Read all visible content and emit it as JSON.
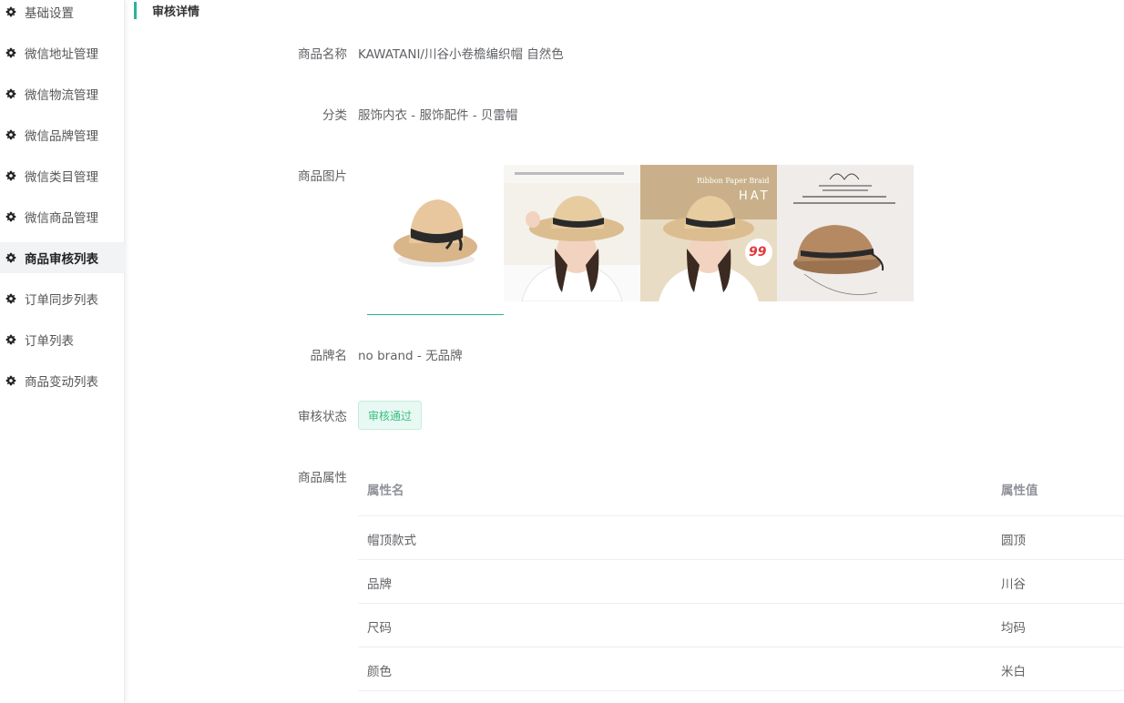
{
  "sidebar": {
    "items": [
      {
        "label": "基础设置"
      },
      {
        "label": "微信地址管理"
      },
      {
        "label": "微信物流管理"
      },
      {
        "label": "微信品牌管理"
      },
      {
        "label": "微信类目管理"
      },
      {
        "label": "微信商品管理"
      },
      {
        "label": "商品审核列表"
      },
      {
        "label": "订单同步列表"
      },
      {
        "label": "订单列表"
      },
      {
        "label": "商品变动列表"
      }
    ],
    "active_index": 6,
    "icon": "gear-icon"
  },
  "header": {
    "title": "审核详情",
    "accent_color": "#2bb39b"
  },
  "detail": {
    "name_label": "商品名称",
    "name_value": "KAWATANI/川谷小卷檐编织帽 自然色",
    "category_label": "分类",
    "category_value": "服饰内衣 - 服饰配件 - 贝雷帽",
    "images_label": "商品图片",
    "brand_label": "品牌名",
    "brand_value": "no brand - 无品牌",
    "status_label": "审核状态",
    "status_value": "审核通过",
    "status_color": "#3bbf84",
    "attrs_label": "商品属性"
  },
  "attributes": {
    "col_name": "属性名",
    "col_value": "属性值",
    "rows": [
      {
        "name": "帽顶款式",
        "value": "圆顶"
      },
      {
        "name": "品牌",
        "value": "川谷"
      },
      {
        "name": "尺码",
        "value": "均码"
      },
      {
        "name": "颜色",
        "value": "米白"
      }
    ]
  },
  "images": {
    "img2_caption": "Ribbon Paper Braid",
    "img2_word": "HAT",
    "img2_price": "99"
  }
}
